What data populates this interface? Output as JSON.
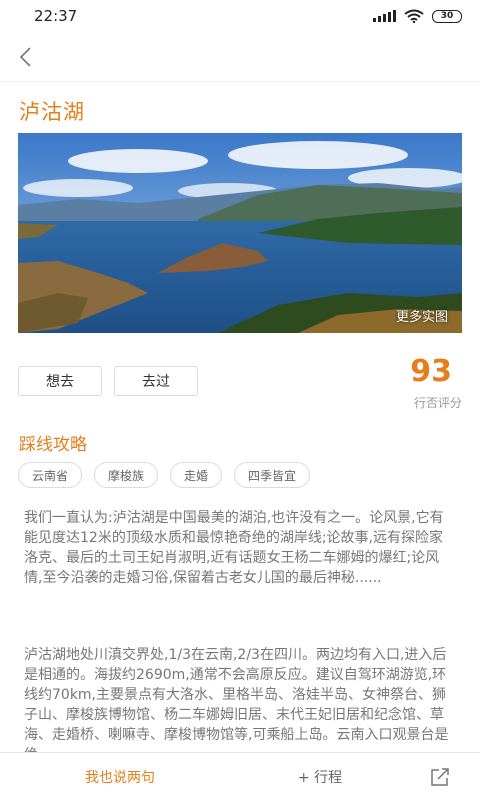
{
  "status_bar": {
    "time": "22:37",
    "battery": "30"
  },
  "page": {
    "title": "泸沽湖"
  },
  "hero": {
    "more_photos_label": "更多实图"
  },
  "actions": {
    "want_label": "想去",
    "been_label": "去过"
  },
  "rating": {
    "score": "93",
    "label": "行否评分"
  },
  "guide": {
    "title": "踩线攻略",
    "tags": [
      "云南省",
      "摩梭族",
      "走婚",
      "四季皆宜"
    ]
  },
  "description": {
    "p1": "我们一直认为:泸沽湖是中国最美的湖泊,也许没有之一。论风景,它有能见度达12米的顶级水质和最惊艳奇绝的湖岸线;论故事,远有探险家洛克、最后的土司王妃肖淑明,近有话题女王杨二车娜姆的爆红;论风情,至今沿袭的走婚习俗,保留着古老女儿国的最后神秘......",
    "p2": "泸沽湖地处川滇交界处,1/3在云南,2/3在四川。两边均有入口,进入后是相通的。海拔约2690m,通常不会高原反应。建议自驾环湖游览,环线约70km,主要景点有大洛水、里格半岛、洛娃半岛、女神祭台、狮子山、摩梭族博物馆、杨二车娜姆旧居、末代王妃旧居和纪念馆、草海、走婚桥、喇嘛寺、摩梭博物馆等,可乘船上岛。云南入口观景台是绝"
  },
  "bottom_bar": {
    "comment_label": "我也说两句",
    "trip_label": "+ 行程"
  },
  "colors": {
    "accent": "#e57f1e",
    "text_body": "#777777",
    "border": "#dcdcdc"
  },
  "icons": [
    "back-arrow-icon",
    "signal-icon",
    "wifi-icon",
    "battery-icon",
    "share-icon"
  ]
}
